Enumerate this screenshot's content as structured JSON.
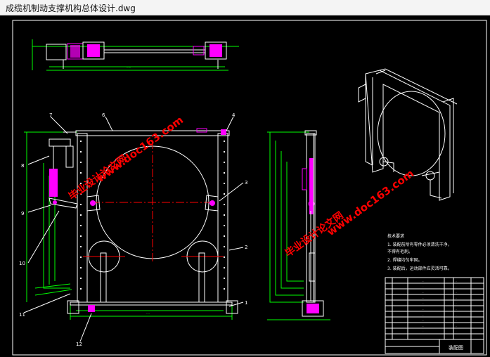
{
  "window": {
    "title": "成缆机制动支撑机构总体设计.dwg"
  },
  "callouts": [
    "1",
    "2",
    "3",
    "4",
    "6",
    "7",
    "8",
    "9",
    "10",
    "11",
    "12"
  ],
  "watermarks": {
    "site_a": "www.doc163.com",
    "name_a": "毕业设计论文网",
    "site_b": "www.doc163.com",
    "name_b": "毕业设计论文网"
  },
  "notes": {
    "heading": "技术要求",
    "item1": "1. 装配前所有零件必须清洗干净，",
    "item1b": "不得有毛刺。",
    "item2": "2. 焊缝均匀牢固。",
    "item3": "3. 装配后，运动部件应灵活可靠。"
  },
  "title_block": {
    "name": "装配图"
  },
  "colors": {
    "background": "#000000",
    "outline": "#ffffff",
    "dimension": "#00ff00",
    "centerline": "#ff0000",
    "part": "#ff00ff",
    "watermark": "#ff0000"
  }
}
